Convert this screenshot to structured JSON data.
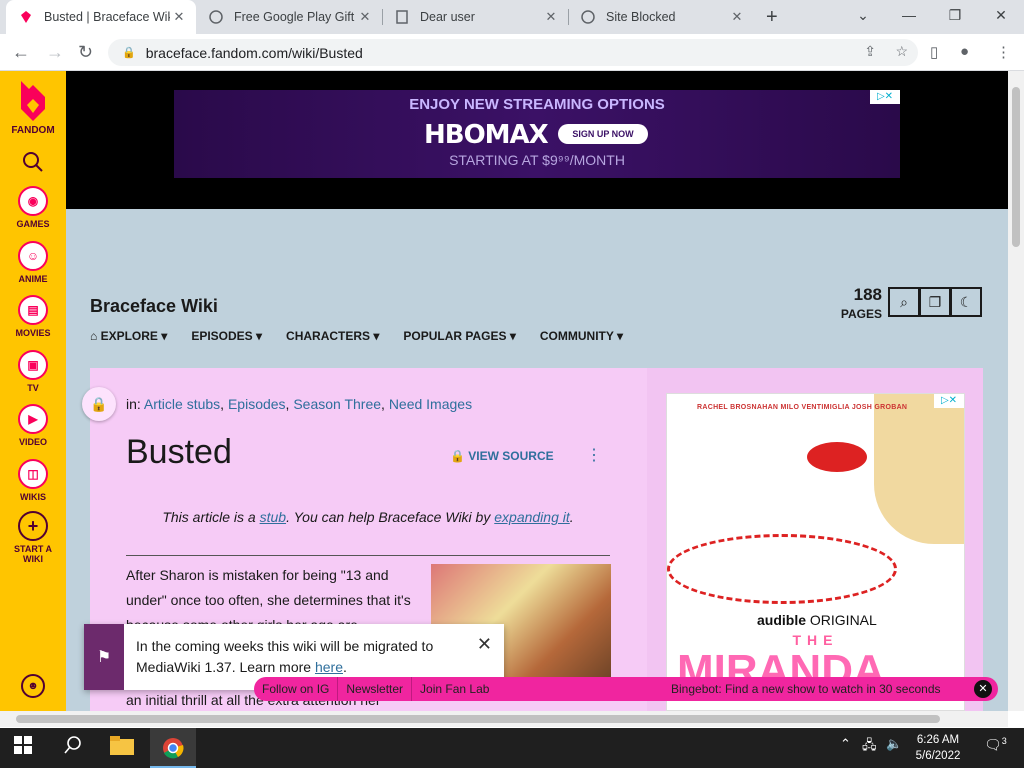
{
  "browser": {
    "tabs": [
      {
        "title": "Busted | Braceface Wiki | F",
        "active": true
      },
      {
        "title": "Free Google Play Gift C"
      },
      {
        "title": "Dear user"
      },
      {
        "title": "Site Blocked"
      }
    ],
    "url": "braceface.fandom.com/wiki/Busted"
  },
  "fandom_sidebar": {
    "brand": "FANDOM",
    "items": [
      {
        "label": "GAMES",
        "icon": "gamepad-icon"
      },
      {
        "label": "ANIME",
        "icon": "anime-face-icon"
      },
      {
        "label": "MOVIES",
        "icon": "film-icon"
      },
      {
        "label": "TV",
        "icon": "tv-icon"
      },
      {
        "label": "VIDEO",
        "icon": "play-icon"
      },
      {
        "label": "WIKIS",
        "icon": "book-icon"
      },
      {
        "label": "START A WIKI",
        "icon": "plus-icon"
      }
    ]
  },
  "top_ad": {
    "line1": "ENJOY NEW STREAMING OPTIONS",
    "brand": "HBOMAX",
    "cta": "SIGN UP NOW",
    "line3": "STARTING AT $9⁹⁹/MONTH"
  },
  "wiki": {
    "title": "Braceface Wiki",
    "page_count": "188",
    "page_count_label": "PAGES",
    "nav": [
      "EXPLORE",
      "EPISODES",
      "CHARACTERS",
      "POPULAR PAGES",
      "COMMUNITY"
    ]
  },
  "article": {
    "categories_prefix": "in:",
    "categories": [
      "Article stubs",
      "Episodes",
      "Season Three",
      "Need Images"
    ],
    "title": "Busted",
    "view_source": "VIEW SOURCE",
    "stub_pre": "This article is a ",
    "stub_link": "stub",
    "stub_mid": ". You can help Braceface Wiki by ",
    "stub_link2": "expanding it",
    "stub_end": ".",
    "body": "After Sharon is mistaken for being \"13 and under\" once too often, she determines that it's because some other girls her age are",
    "body_tail": "an initial thrill at all the extra attention her"
  },
  "side_ad": {
    "names": "RACHEL BROSNAHAN   MILO VENTIMIGLIA   JOSH GROBAN",
    "audible": "audible",
    "original": "ORIGINAL",
    "the": "THE",
    "miranda": "MIRANDA"
  },
  "notice": {
    "text": "In the coming weeks this wiki will be migrated to MediaWiki 1.37. Learn more ",
    "link": "here",
    "end": "."
  },
  "bottom_bar": {
    "links": [
      "Follow on IG",
      "Newsletter",
      "Join Fan Lab"
    ],
    "bingebot": "Bingebot: Find a new show to watch in 30 seconds"
  },
  "taskbar": {
    "time": "6:26 AM",
    "date": "5/6/2022",
    "notifications": "3"
  }
}
